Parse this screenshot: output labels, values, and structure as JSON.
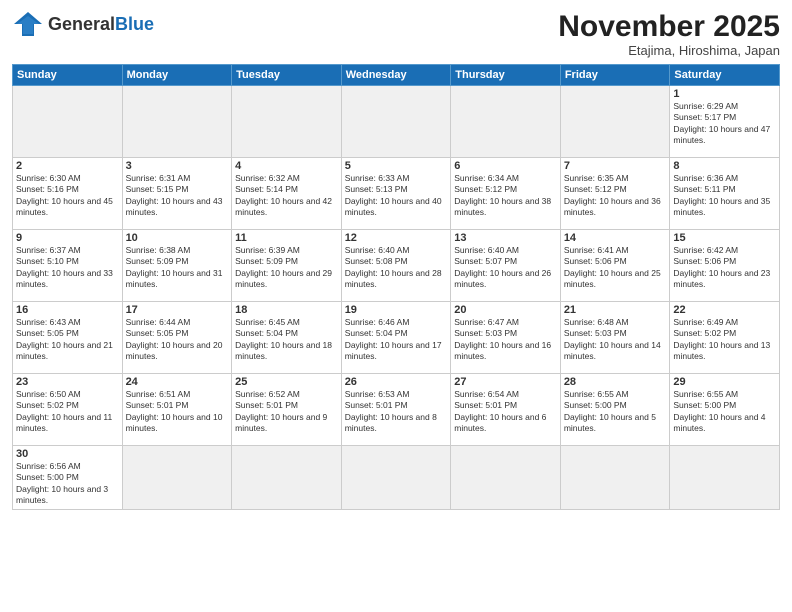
{
  "header": {
    "logo_general": "General",
    "logo_blue": "Blue",
    "month_title": "November 2025",
    "location": "Etajima, Hiroshima, Japan"
  },
  "weekdays": [
    "Sunday",
    "Monday",
    "Tuesday",
    "Wednesday",
    "Thursday",
    "Friday",
    "Saturday"
  ],
  "days": {
    "1": {
      "sunrise": "6:29 AM",
      "sunset": "5:17 PM",
      "daylight": "10 hours and 47 minutes."
    },
    "2": {
      "sunrise": "6:30 AM",
      "sunset": "5:16 PM",
      "daylight": "10 hours and 45 minutes."
    },
    "3": {
      "sunrise": "6:31 AM",
      "sunset": "5:15 PM",
      "daylight": "10 hours and 43 minutes."
    },
    "4": {
      "sunrise": "6:32 AM",
      "sunset": "5:14 PM",
      "daylight": "10 hours and 42 minutes."
    },
    "5": {
      "sunrise": "6:33 AM",
      "sunset": "5:13 PM",
      "daylight": "10 hours and 40 minutes."
    },
    "6": {
      "sunrise": "6:34 AM",
      "sunset": "5:12 PM",
      "daylight": "10 hours and 38 minutes."
    },
    "7": {
      "sunrise": "6:35 AM",
      "sunset": "5:12 PM",
      "daylight": "10 hours and 36 minutes."
    },
    "8": {
      "sunrise": "6:36 AM",
      "sunset": "5:11 PM",
      "daylight": "10 hours and 35 minutes."
    },
    "9": {
      "sunrise": "6:37 AM",
      "sunset": "5:10 PM",
      "daylight": "10 hours and 33 minutes."
    },
    "10": {
      "sunrise": "6:38 AM",
      "sunset": "5:09 PM",
      "daylight": "10 hours and 31 minutes."
    },
    "11": {
      "sunrise": "6:39 AM",
      "sunset": "5:09 PM",
      "daylight": "10 hours and 29 minutes."
    },
    "12": {
      "sunrise": "6:40 AM",
      "sunset": "5:08 PM",
      "daylight": "10 hours and 28 minutes."
    },
    "13": {
      "sunrise": "6:40 AM",
      "sunset": "5:07 PM",
      "daylight": "10 hours and 26 minutes."
    },
    "14": {
      "sunrise": "6:41 AM",
      "sunset": "5:06 PM",
      "daylight": "10 hours and 25 minutes."
    },
    "15": {
      "sunrise": "6:42 AM",
      "sunset": "5:06 PM",
      "daylight": "10 hours and 23 minutes."
    },
    "16": {
      "sunrise": "6:43 AM",
      "sunset": "5:05 PM",
      "daylight": "10 hours and 21 minutes."
    },
    "17": {
      "sunrise": "6:44 AM",
      "sunset": "5:05 PM",
      "daylight": "10 hours and 20 minutes."
    },
    "18": {
      "sunrise": "6:45 AM",
      "sunset": "5:04 PM",
      "daylight": "10 hours and 18 minutes."
    },
    "19": {
      "sunrise": "6:46 AM",
      "sunset": "5:04 PM",
      "daylight": "10 hours and 17 minutes."
    },
    "20": {
      "sunrise": "6:47 AM",
      "sunset": "5:03 PM",
      "daylight": "10 hours and 16 minutes."
    },
    "21": {
      "sunrise": "6:48 AM",
      "sunset": "5:03 PM",
      "daylight": "10 hours and 14 minutes."
    },
    "22": {
      "sunrise": "6:49 AM",
      "sunset": "5:02 PM",
      "daylight": "10 hours and 13 minutes."
    },
    "23": {
      "sunrise": "6:50 AM",
      "sunset": "5:02 PM",
      "daylight": "10 hours and 11 minutes."
    },
    "24": {
      "sunrise": "6:51 AM",
      "sunset": "5:01 PM",
      "daylight": "10 hours and 10 minutes."
    },
    "25": {
      "sunrise": "6:52 AM",
      "sunset": "5:01 PM",
      "daylight": "10 hours and 9 minutes."
    },
    "26": {
      "sunrise": "6:53 AM",
      "sunset": "5:01 PM",
      "daylight": "10 hours and 8 minutes."
    },
    "27": {
      "sunrise": "6:54 AM",
      "sunset": "5:01 PM",
      "daylight": "10 hours and 6 minutes."
    },
    "28": {
      "sunrise": "6:55 AM",
      "sunset": "5:00 PM",
      "daylight": "10 hours and 5 minutes."
    },
    "29": {
      "sunrise": "6:55 AM",
      "sunset": "5:00 PM",
      "daylight": "10 hours and 4 minutes."
    },
    "30": {
      "sunrise": "6:56 AM",
      "sunset": "5:00 PM",
      "daylight": "10 hours and 3 minutes."
    }
  }
}
